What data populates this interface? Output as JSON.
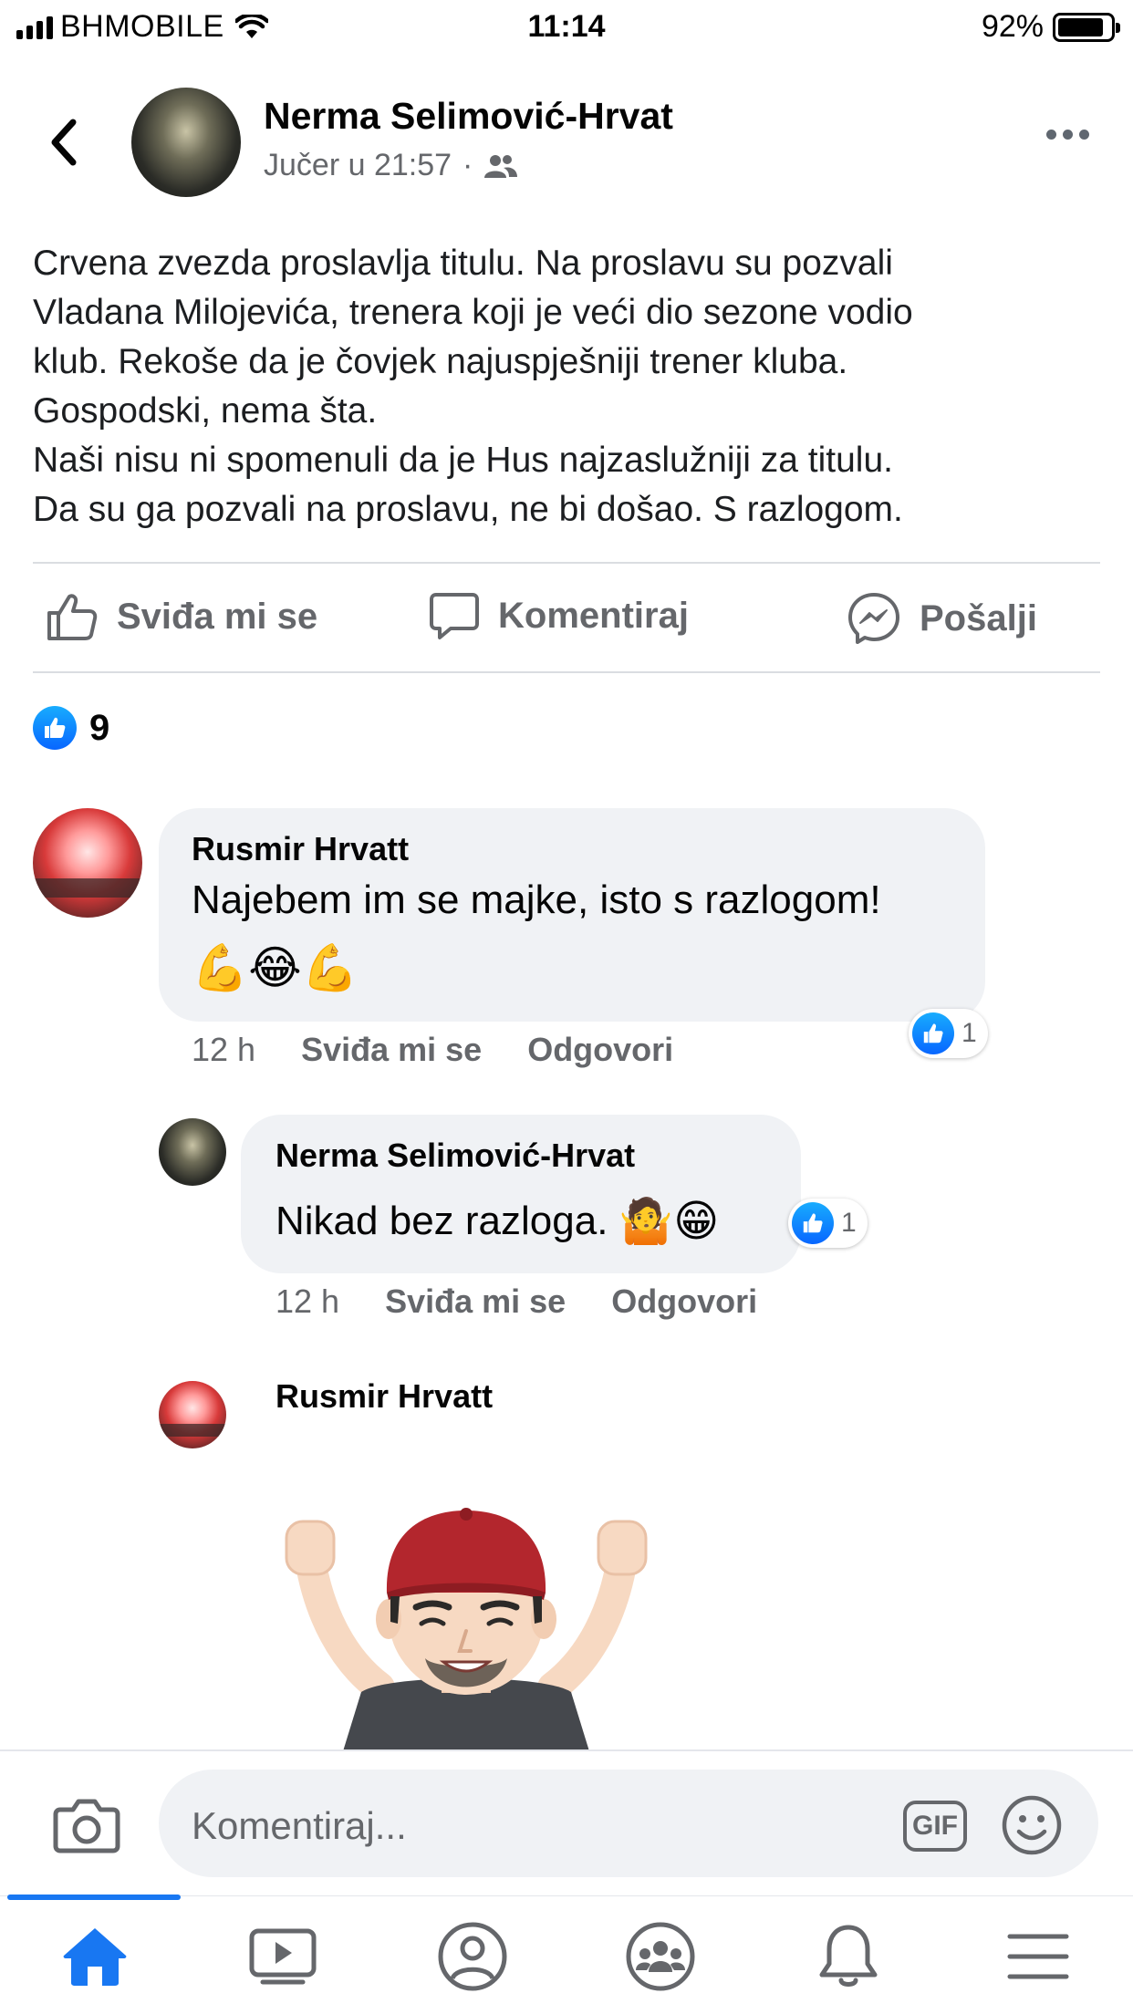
{
  "status_bar": {
    "carrier": "BHMOBILE",
    "time": "11:14",
    "battery": "92%"
  },
  "post": {
    "author": "Nerma Selimović-Hrvat",
    "time": "Jučer u 21:57",
    "time_separator": "·",
    "audience_icon": "friends-icon",
    "text_lines": [
      "Crvena zvezda proslavlja titulu. Na proslavu su pozvali",
      "Vladana Milojevića, trenera koji je veći dio sezone vodio",
      "klub. Rekoše da je čovjek najuspješniji trener kluba.",
      "Gospodski, nema šta.",
      "Naši nisu ni spomenuli da je Hus najzaslužniji za titulu.",
      "Da su ga pozvali na proslavu, ne bi došao. S razlogom."
    ]
  },
  "actions": {
    "like": "Sviđa mi se",
    "comment": "Komentiraj",
    "send": "Pošalji"
  },
  "reactions": {
    "count": "9"
  },
  "comments": [
    {
      "author": "Rusmir Hrvatt",
      "text": "Najebem im se majke, isto s razlogom!",
      "emojis": "💪😂💪",
      "time": "12 h",
      "like_label": "Sviđa mi se",
      "reply_label": "Odgovori",
      "reaction_count": "1"
    },
    {
      "author": "Nerma Selimović-Hrvat",
      "text": "Nikad bez razloga.",
      "emojis": "🤷😁",
      "time": "12 h",
      "like_label": "Sviđa mi se",
      "reply_label": "Odgovori",
      "reaction_count": "1"
    },
    {
      "author": "Rusmir Hrvatt",
      "sticker": "avatar-celebration-sticker"
    }
  ],
  "composer": {
    "placeholder": "Komentiraj...",
    "gif_label": "GIF"
  },
  "tabs": [
    "home-icon",
    "watch-icon",
    "profile-icon",
    "groups-icon",
    "notifications-icon",
    "menu-icon"
  ],
  "colors": {
    "accent": "#1877f2",
    "bubble": "#f0f2f5",
    "secondary_text": "#65676b"
  }
}
